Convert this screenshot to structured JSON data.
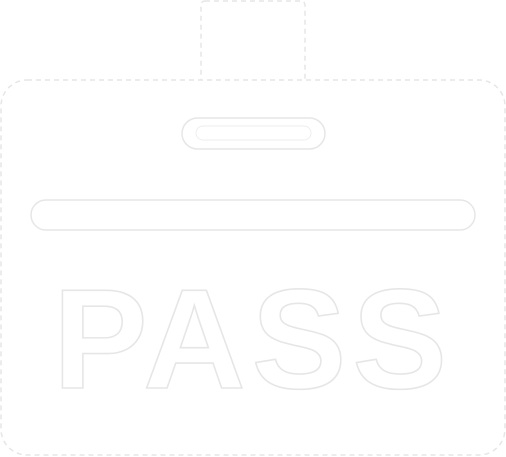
{
  "badge": {
    "label": "PASS",
    "icon": "id-badge-pass-icon",
    "fill_color": "#ffffff",
    "outline_color": "#e6e6e6",
    "background_color": "#ffffff"
  }
}
